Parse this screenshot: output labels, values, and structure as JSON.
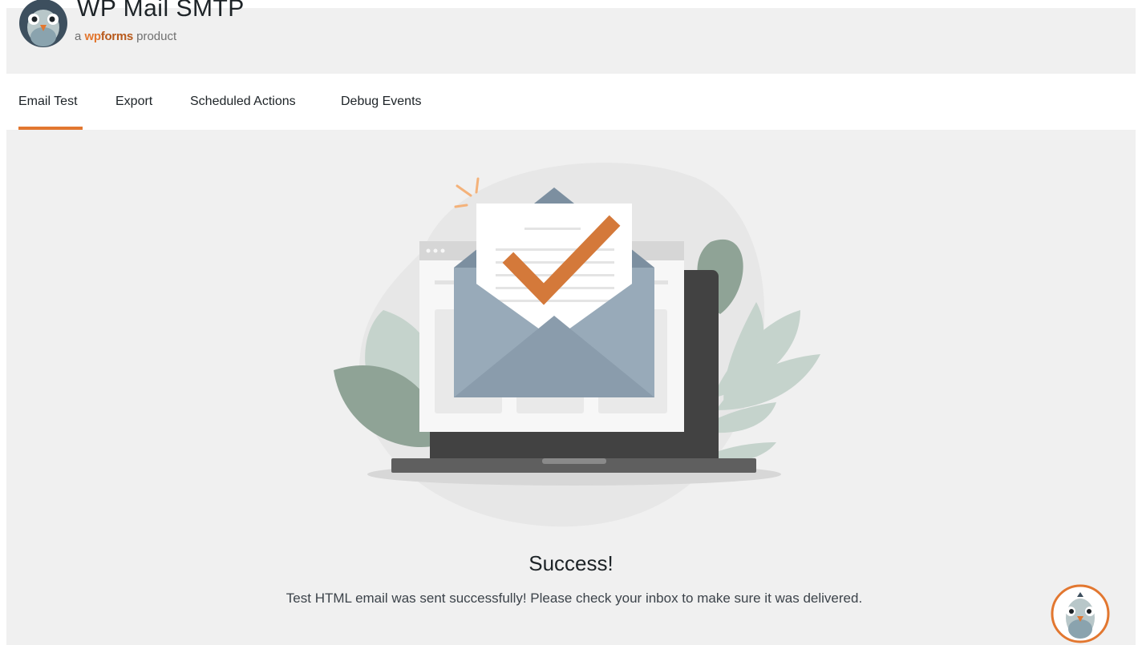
{
  "header": {
    "title": "WP Mail SMTP",
    "subtitle_prefix": "a",
    "subtitle_brand_wp": "wp",
    "subtitle_brand_forms": "forms",
    "subtitle_suffix": "product",
    "logo_icon": "pigeon-mascot-icon"
  },
  "tabs": [
    {
      "label": "Email Test",
      "active": true
    },
    {
      "label": "Export",
      "active": false
    },
    {
      "label": "Scheduled Actions",
      "active": false
    },
    {
      "label": "Debug Events",
      "active": false
    }
  ],
  "result": {
    "title": "Success!",
    "message": "Test HTML email was sent successfully! Please check your inbox to make sure it was delivered.",
    "illustration": "laptop-envelope-checkmark-illustration"
  },
  "help": {
    "icon": "pigeon-mascot-icon"
  },
  "colors": {
    "accent": "#e27730",
    "header_bg": "#f0f0f0",
    "check": "#d4793a",
    "envelope": "#8a9cac"
  }
}
